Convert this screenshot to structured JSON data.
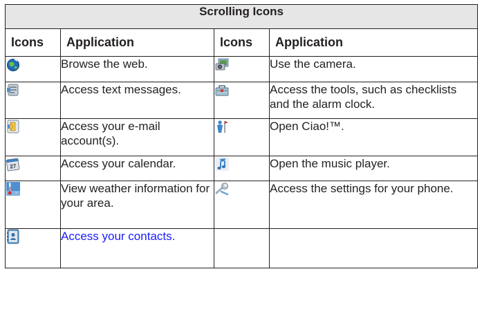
{
  "table": {
    "title": "Scrolling Icons",
    "headers": [
      "Icons",
      "Application",
      "Icons",
      "Application"
    ],
    "rows": [
      {
        "left_icon": "globe-icon",
        "left_text": "Browse the web.",
        "right_icon": "camera-icon",
        "right_text": "Use the camera."
      },
      {
        "left_icon": "messages-icon",
        "left_text": "Access text messages.",
        "right_icon": "toolbox-icon",
        "right_text": "Access the tools, such as checklists and the alarm clock."
      },
      {
        "left_icon": "email-icon",
        "left_text": "Access your e-mail account(s).",
        "right_icon": "ciao-icon",
        "right_text": "Open Ciao!™."
      },
      {
        "left_icon": "calendar-icon",
        "left_text": "Access your calendar.",
        "right_icon": "music-icon",
        "right_text": "Open the music player."
      },
      {
        "left_icon": "weather-icon",
        "left_text": "View weather information for your area.",
        "right_icon": "settings-wrench-icon",
        "right_text": "Access the settings for your phone."
      },
      {
        "left_icon": "contacts-icon",
        "left_text": "Access your contacts.",
        "right_icon": "",
        "right_text": ""
      }
    ],
    "calendar_icon_day": "27"
  },
  "colors": {
    "border": "#231f20",
    "title_bg": "#e6e6e6",
    "link_text": "#1a1aff"
  }
}
